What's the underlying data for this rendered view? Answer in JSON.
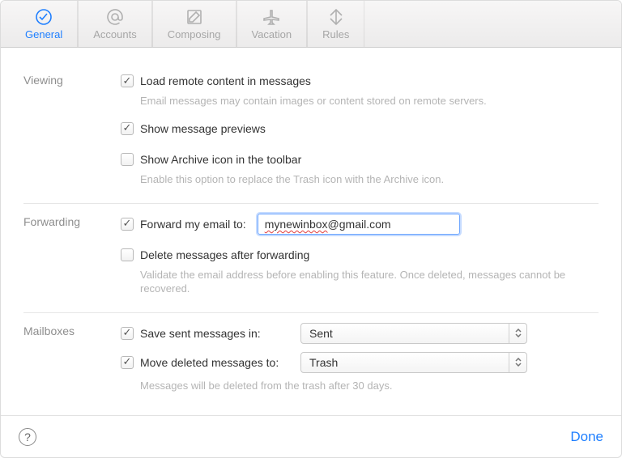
{
  "tabs": {
    "general": "General",
    "accounts": "Accounts",
    "composing": "Composing",
    "vacation": "Vacation",
    "rules": "Rules"
  },
  "sections": {
    "viewing": "Viewing",
    "forwarding": "Forwarding",
    "mailboxes": "Mailboxes"
  },
  "viewing": {
    "load_remote": "Load remote content in messages",
    "load_remote_hint": "Email messages may contain images or content stored on remote servers.",
    "show_previews": "Show message previews",
    "show_archive": "Show Archive icon in the toolbar",
    "show_archive_hint": "Enable this option to replace the Trash icon with the Archive icon."
  },
  "forwarding": {
    "forward_label": "Forward my email to:",
    "forward_value_word": "mynewinbox",
    "forward_value_rest": "@gmail.com",
    "delete_after": "Delete messages after forwarding",
    "delete_hint": "Validate the email address before enabling this feature. Once deleted, messages cannot be recovered."
  },
  "mailboxes": {
    "save_sent": "Save sent messages in:",
    "save_sent_value": "Sent",
    "move_deleted": "Move deleted messages to:",
    "move_deleted_value": "Trash",
    "trash_hint": "Messages will be deleted from the trash after 30 days."
  },
  "footer": {
    "done": "Done"
  }
}
